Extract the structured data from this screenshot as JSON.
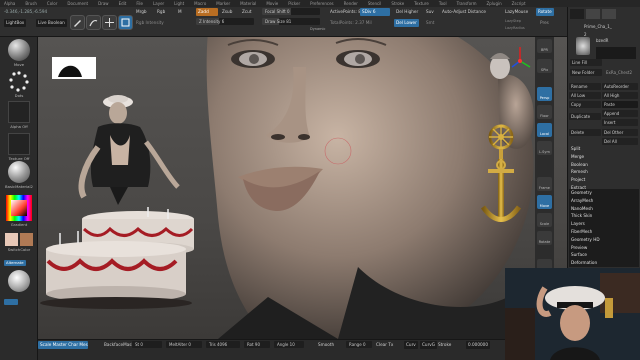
{
  "menubar": [
    "Alpha",
    "Brush",
    "Color",
    "Document",
    "Draw",
    "Edit",
    "File",
    "Layer",
    "Light",
    "Macro",
    "Marker",
    "Material",
    "Movie",
    "Picker",
    "Preferences",
    "Render",
    "Stencil",
    "Stroke",
    "Texture",
    "Tool",
    "Transform",
    "Zplugin",
    "Zscript"
  ],
  "topshelf": {
    "coords": "-0.346,-1.285,-6.594",
    "lightbox": "LightBox",
    "live_boolean": "Live Boolean",
    "mrgb": "Mrgb",
    "rgb": "Rgb",
    "m": "M",
    "rgb_intensity": "Rgb Intensity",
    "zadd": "Zadd",
    "zsub": "Zsub",
    "zcut": "Zcut",
    "z_intensity": "Z Intensity",
    "z_intensity_value": "6",
    "focal_shift": "Focal Shift",
    "focal_shift_value": "0",
    "draw_size": "Draw Size",
    "draw_size_value": "81",
    "dynamic": "Dynamic",
    "active_points": "ActivePoints: 8,750",
    "total_points": "TotalPoints: 2.37 Mil",
    "sdiv": "SDiv",
    "sdiv_value": "6",
    "smt": "Smt",
    "suv": "Suv",
    "del_higher": "Del Higher",
    "del_lower": "Del Lower",
    "auto_adjust": "Auto-Adjust Distance",
    "lazy_mouse": "LazyMouse",
    "lazy_step": "LazyStep",
    "lazy_radius": "LazyRadius",
    "lazy_smooth": "LazySmooth",
    "rotate": "Rotate",
    "pres": "Pres"
  },
  "leftshelf": {
    "move": "Move",
    "dots": "Dots",
    "alpha_off": "Alpha Off",
    "texture_off": "Texture Off",
    "material": "BasicMaterial2",
    "gradient": "Gradient",
    "switch_color": "SwitchColor",
    "alternate": "Alternate",
    "color_primary": "#e8c9b8",
    "color_secondary": "#b07a55"
  },
  "bottombar": {
    "brush_name": "Scale Master Char Mesh",
    "backface": "BackfaceMask",
    "st": "St",
    "st_value": "0",
    "melt": "MeltAlter",
    "melt_value": "0",
    "tris": "Tris",
    "tris_value": "4096",
    "rot": "Rot",
    "rot_value": "90",
    "angle": "Angle",
    "angle_value": "10",
    "smooth": "Smooth",
    "range": "Range",
    "range_value": "0",
    "clear_tx": "Clear Tx",
    "curve": "Curv",
    "curve_b": "CurvG",
    "stroke": "Stroke",
    "scale_value": "0.000000"
  },
  "rightstrip": [
    "BPR",
    "SPix",
    "Persp",
    "Floor",
    "Local",
    "L.Sym",
    "Frame",
    "Move",
    "Scale",
    "Rotate",
    "Transp",
    "Ghost"
  ],
  "rightpanel": {
    "head": "Prime_Cha_1_",
    "count": "2",
    "subtool_name": "bzedR",
    "row1": "Line Fill",
    "row2": "New Folder",
    "extra_label": "ExRa_Chest2",
    "rename": "Rename",
    "autoreorder": "AutoReorder",
    "all_low": "All Low",
    "all_high": "All High",
    "copy": "Copy",
    "paste": "Paste",
    "append": "Append",
    "duplicate": "Duplicate",
    "insert": "Insert",
    "delete": "Delete",
    "del_other": "Del Other",
    "del_all": "Del All",
    "split": "Split",
    "merge": "Merge",
    "boolean": "Boolean",
    "remesh": "Remesh",
    "project": "Project",
    "extract": "Extract",
    "sections": [
      "Geometry",
      "ArrayMesh",
      "NanoMesh",
      "Thick Skin",
      "Layers",
      "FiberMesh",
      "Geometry HD",
      "Preview",
      "Surface",
      "Deformation"
    ]
  },
  "colors": {
    "accent": "#2e6fa3",
    "panel": "#2e2e2e",
    "orange": "#b86d22"
  },
  "icons": [
    "brush-icon",
    "sphere-icon",
    "gear-icon",
    "eye-icon",
    "folder-icon",
    "lock-icon",
    "move-icon",
    "scale-icon",
    "rotate-icon"
  ]
}
